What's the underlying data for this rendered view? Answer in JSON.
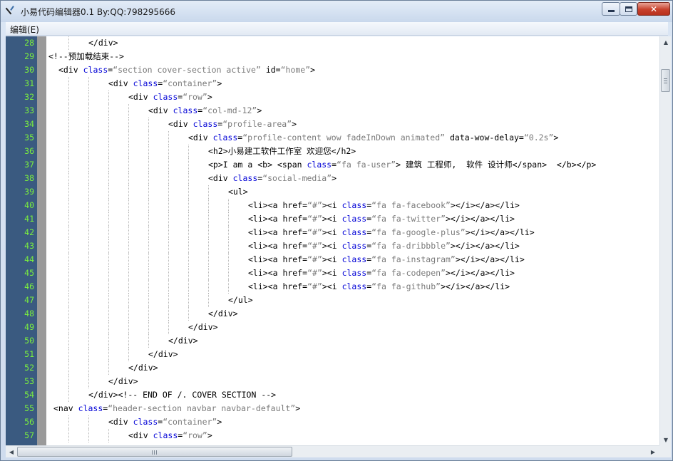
{
  "window": {
    "title": "小易代码编辑器0.1 By:QQ:798295666",
    "icon": "app-feather-icon",
    "controls": {
      "minimize": "minimize-icon",
      "maximize": "maximize-icon",
      "close_label": "✕"
    }
  },
  "menu": {
    "items": [
      {
        "label": "编辑(E)"
      }
    ]
  },
  "colors": {
    "gutter_bg": "#3a5a80",
    "line_number": "#7cf23c",
    "keyword": "#0000d6",
    "string": "#7a7a7a",
    "fold_margin": "#9a9a9a"
  },
  "editor": {
    "lines": [
      {
        "num": "28",
        "indent": 2,
        "tokens": [
          {
            "t": "</div>",
            "c": "p"
          }
        ]
      },
      {
        "num": "29",
        "indent": 0,
        "tokens": [
          {
            "t": "<!--预加载结束-->",
            "c": "p"
          }
        ]
      },
      {
        "num": "30",
        "indent": 0.5,
        "tokens": [
          {
            "t": "<div ",
            "c": "p"
          },
          {
            "t": "class",
            "c": "k"
          },
          {
            "t": "=",
            "c": "p"
          },
          {
            "t": "“section cover-section active”",
            "c": "s"
          },
          {
            "t": " id=",
            "c": "p"
          },
          {
            "t": "“home”",
            "c": "s"
          },
          {
            "t": ">",
            "c": "p"
          }
        ]
      },
      {
        "num": "31",
        "indent": 3,
        "tokens": [
          {
            "t": "<div ",
            "c": "p"
          },
          {
            "t": "class",
            "c": "k"
          },
          {
            "t": "=",
            "c": "p"
          },
          {
            "t": "“container”",
            "c": "s"
          },
          {
            "t": ">",
            "c": "p"
          }
        ]
      },
      {
        "num": "32",
        "indent": 4,
        "tokens": [
          {
            "t": "<div ",
            "c": "p"
          },
          {
            "t": "class",
            "c": "k"
          },
          {
            "t": "=",
            "c": "p"
          },
          {
            "t": "“row”",
            "c": "s"
          },
          {
            "t": ">",
            "c": "p"
          }
        ]
      },
      {
        "num": "33",
        "indent": 5,
        "tokens": [
          {
            "t": "<div ",
            "c": "p"
          },
          {
            "t": "class",
            "c": "k"
          },
          {
            "t": "=",
            "c": "p"
          },
          {
            "t": "“col-md-12”",
            "c": "s"
          },
          {
            "t": ">",
            "c": "p"
          }
        ]
      },
      {
        "num": "34",
        "indent": 6,
        "tokens": [
          {
            "t": "<div ",
            "c": "p"
          },
          {
            "t": "class",
            "c": "k"
          },
          {
            "t": "=",
            "c": "p"
          },
          {
            "t": "“profile-area”",
            "c": "s"
          },
          {
            "t": ">",
            "c": "p"
          }
        ]
      },
      {
        "num": "35",
        "indent": 7,
        "tokens": [
          {
            "t": "<div ",
            "c": "p"
          },
          {
            "t": "class",
            "c": "k"
          },
          {
            "t": "=",
            "c": "p"
          },
          {
            "t": "“profile-content wow fadeInDown animated”",
            "c": "s"
          },
          {
            "t": " data-wow-delay=",
            "c": "p"
          },
          {
            "t": "“0.2s”",
            "c": "s"
          },
          {
            "t": ">",
            "c": "p"
          }
        ]
      },
      {
        "num": "36",
        "indent": 8,
        "tokens": [
          {
            "t": "<h2>小易建工软件工作室 欢迎您</h2>",
            "c": "p"
          }
        ]
      },
      {
        "num": "37",
        "indent": 8,
        "tokens": [
          {
            "t": "<p>I am a <b> <span ",
            "c": "p"
          },
          {
            "t": "class",
            "c": "k"
          },
          {
            "t": "=",
            "c": "p"
          },
          {
            "t": "“fa fa-user”",
            "c": "s"
          },
          {
            "t": "> 建筑 工程师,  软件 设计师</span>  </b></p>",
            "c": "p"
          }
        ]
      },
      {
        "num": "38",
        "indent": 8,
        "tokens": [
          {
            "t": "<div ",
            "c": "p"
          },
          {
            "t": "class",
            "c": "k"
          },
          {
            "t": "=",
            "c": "p"
          },
          {
            "t": "“social-media”",
            "c": "s"
          },
          {
            "t": ">",
            "c": "p"
          }
        ]
      },
      {
        "num": "39",
        "indent": 9,
        "tokens": [
          {
            "t": "<ul>",
            "c": "p"
          }
        ]
      },
      {
        "num": "40",
        "indent": 10,
        "tokens": [
          {
            "t": "<li><a href=",
            "c": "p"
          },
          {
            "t": "“#”",
            "c": "s"
          },
          {
            "t": "><i ",
            "c": "p"
          },
          {
            "t": "class",
            "c": "k"
          },
          {
            "t": "=",
            "c": "p"
          },
          {
            "t": "“fa fa-facebook”",
            "c": "s"
          },
          {
            "t": "></i></a></li>",
            "c": "p"
          }
        ]
      },
      {
        "num": "41",
        "indent": 10,
        "tokens": [
          {
            "t": "<li><a href=",
            "c": "p"
          },
          {
            "t": "“#”",
            "c": "s"
          },
          {
            "t": "><i ",
            "c": "p"
          },
          {
            "t": "class",
            "c": "k"
          },
          {
            "t": "=",
            "c": "p"
          },
          {
            "t": "“fa fa-twitter”",
            "c": "s"
          },
          {
            "t": "></i></a></li>",
            "c": "p"
          }
        ]
      },
      {
        "num": "42",
        "indent": 10,
        "tokens": [
          {
            "t": "<li><a href=",
            "c": "p"
          },
          {
            "t": "“#”",
            "c": "s"
          },
          {
            "t": "><i ",
            "c": "p"
          },
          {
            "t": "class",
            "c": "k"
          },
          {
            "t": "=",
            "c": "p"
          },
          {
            "t": "“fa fa-google-plus”",
            "c": "s"
          },
          {
            "t": "></i></a></li>",
            "c": "p"
          }
        ]
      },
      {
        "num": "43",
        "indent": 10,
        "tokens": [
          {
            "t": "<li><a href=",
            "c": "p"
          },
          {
            "t": "“#”",
            "c": "s"
          },
          {
            "t": "><i ",
            "c": "p"
          },
          {
            "t": "class",
            "c": "k"
          },
          {
            "t": "=",
            "c": "p"
          },
          {
            "t": "“fa fa-dribbble”",
            "c": "s"
          },
          {
            "t": "></i></a></li>",
            "c": "p"
          }
        ]
      },
      {
        "num": "44",
        "indent": 10,
        "tokens": [
          {
            "t": "<li><a href=",
            "c": "p"
          },
          {
            "t": "“#”",
            "c": "s"
          },
          {
            "t": "><i ",
            "c": "p"
          },
          {
            "t": "class",
            "c": "k"
          },
          {
            "t": "=",
            "c": "p"
          },
          {
            "t": "“fa fa-instagram”",
            "c": "s"
          },
          {
            "t": "></i></a></li>",
            "c": "p"
          }
        ]
      },
      {
        "num": "45",
        "indent": 10,
        "tokens": [
          {
            "t": "<li><a href=",
            "c": "p"
          },
          {
            "t": "“#”",
            "c": "s"
          },
          {
            "t": "><i ",
            "c": "p"
          },
          {
            "t": "class",
            "c": "k"
          },
          {
            "t": "=",
            "c": "p"
          },
          {
            "t": "“fa fa-codepen”",
            "c": "s"
          },
          {
            "t": "></i></a></li>",
            "c": "p"
          }
        ]
      },
      {
        "num": "46",
        "indent": 10,
        "tokens": [
          {
            "t": "<li><a href=",
            "c": "p"
          },
          {
            "t": "“#”",
            "c": "s"
          },
          {
            "t": "><i ",
            "c": "p"
          },
          {
            "t": "class",
            "c": "k"
          },
          {
            "t": "=",
            "c": "p"
          },
          {
            "t": "“fa fa-github”",
            "c": "s"
          },
          {
            "t": "></i></a></li>",
            "c": "p"
          }
        ]
      },
      {
        "num": "47",
        "indent": 9,
        "tokens": [
          {
            "t": "</ul>",
            "c": "p"
          }
        ]
      },
      {
        "num": "48",
        "indent": 8,
        "tokens": [
          {
            "t": "</div>",
            "c": "p"
          }
        ]
      },
      {
        "num": "49",
        "indent": 7,
        "tokens": [
          {
            "t": "</div>",
            "c": "p"
          }
        ]
      },
      {
        "num": "50",
        "indent": 6,
        "tokens": [
          {
            "t": "</div>",
            "c": "p"
          }
        ]
      },
      {
        "num": "51",
        "indent": 5,
        "tokens": [
          {
            "t": "</div>",
            "c": "p"
          }
        ]
      },
      {
        "num": "52",
        "indent": 4,
        "tokens": [
          {
            "t": "</div>",
            "c": "p"
          }
        ]
      },
      {
        "num": "53",
        "indent": 3,
        "tokens": [
          {
            "t": "</div>",
            "c": "p"
          }
        ]
      },
      {
        "num": "54",
        "indent": 2,
        "tokens": [
          {
            "t": "</div><!-- END OF /. COVER SECTION -->",
            "c": "p"
          }
        ]
      },
      {
        "num": "55",
        "indent": 0.25,
        "tokens": [
          {
            "t": "<nav ",
            "c": "p"
          },
          {
            "t": "class",
            "c": "k"
          },
          {
            "t": "=",
            "c": "p"
          },
          {
            "t": "“header-section navbar navbar-default”",
            "c": "s"
          },
          {
            "t": ">",
            "c": "p"
          }
        ]
      },
      {
        "num": "56",
        "indent": 3,
        "tokens": [
          {
            "t": "<div ",
            "c": "p"
          },
          {
            "t": "class",
            "c": "k"
          },
          {
            "t": "=",
            "c": "p"
          },
          {
            "t": "“container”",
            "c": "s"
          },
          {
            "t": ">",
            "c": "p"
          }
        ]
      },
      {
        "num": "57",
        "indent": 4,
        "tokens": [
          {
            "t": "<div ",
            "c": "p"
          },
          {
            "t": "class",
            "c": "k"
          },
          {
            "t": "=",
            "c": "p"
          },
          {
            "t": "“row”",
            "c": "s"
          },
          {
            "t": ">",
            "c": "p"
          }
        ]
      }
    ]
  },
  "scrollbars": {
    "vertical": {
      "up": "▲",
      "down": "▼"
    },
    "horizontal": {
      "left": "◀",
      "right": "▶"
    }
  }
}
